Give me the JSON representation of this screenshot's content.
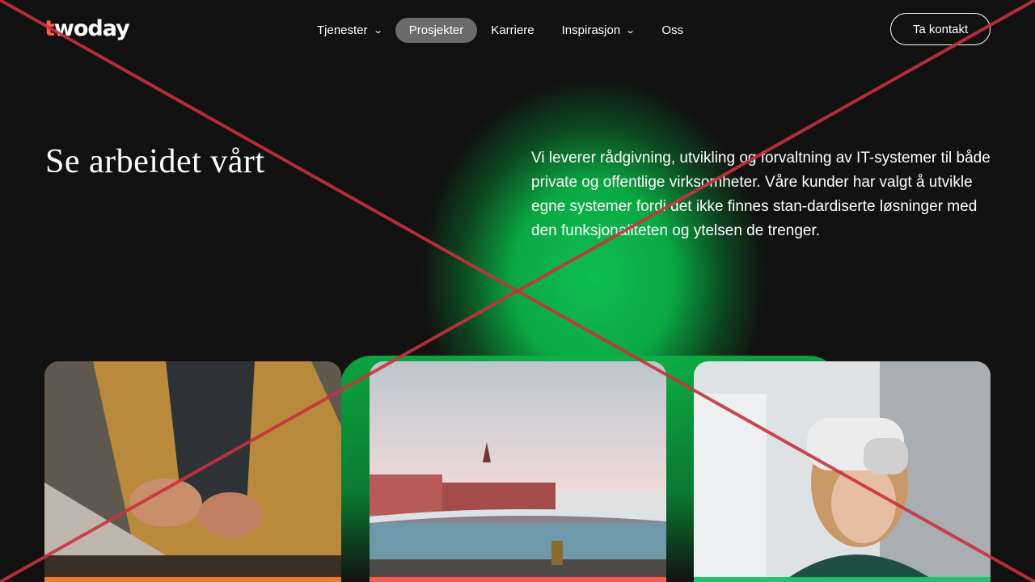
{
  "header": {
    "logo_prefix": "t",
    "logo_rest": "woday",
    "nav": [
      {
        "label": "Tjenester",
        "has_dropdown": true,
        "active": false
      },
      {
        "label": "Prosjekter",
        "has_dropdown": false,
        "active": true
      },
      {
        "label": "Karriere",
        "has_dropdown": false,
        "active": false
      },
      {
        "label": "Inspirasjon",
        "has_dropdown": true,
        "active": false
      },
      {
        "label": "Oss",
        "has_dropdown": false,
        "active": false
      }
    ],
    "cta_label": "Ta kontakt"
  },
  "hero": {
    "title": "Se arbeidet vårt",
    "intro": "Vi leverer rådgivning, utvikling og forvaltning av IT-systemer til både private og offentlige virksomheter. Våre kunder har valgt å utvikle egne systemer fordi det ikke finnes stan-dardiserte løsninger med den funksjonaliteten og ytelsen de trenger."
  },
  "cards": [
    {
      "image": "person-typing-on-laptop",
      "accent": "#f07b2a"
    },
    {
      "image": "harbour-city-bridge",
      "accent": "#ff5a4e"
    },
    {
      "image": "woman-wearing-vr-headset",
      "accent": "#1ec26a"
    }
  ],
  "colors": {
    "background": "#111111",
    "brand_accent": "#ff5a4e",
    "glow": "#0aa843",
    "overlay_cross": "#c8323c"
  }
}
